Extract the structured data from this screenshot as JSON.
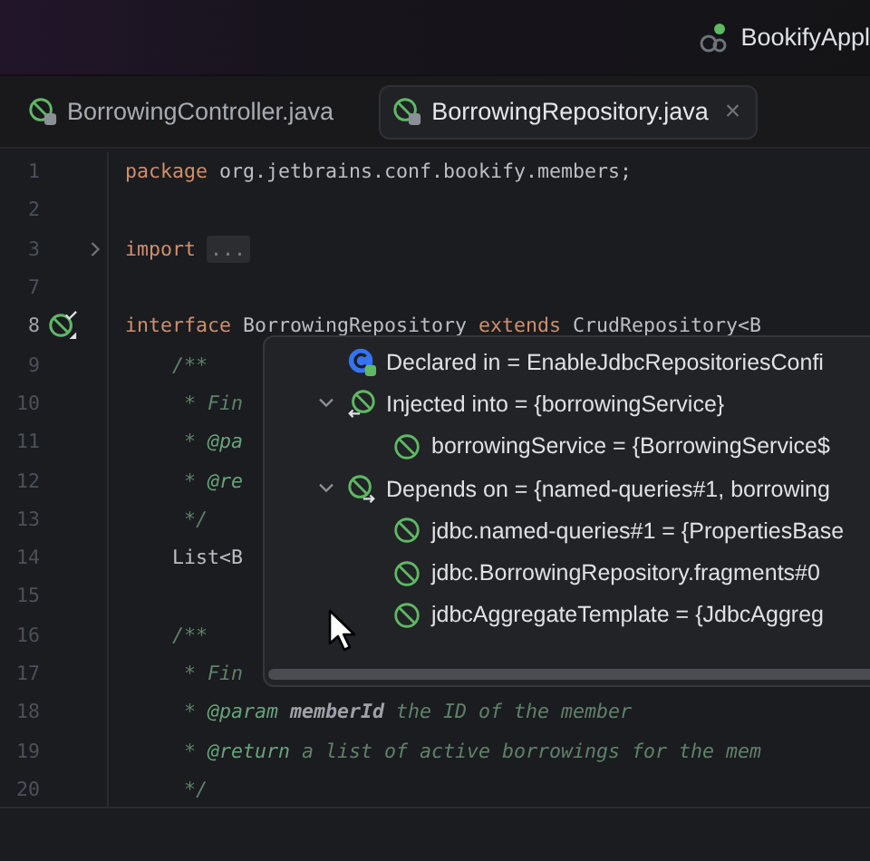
{
  "title_bar": {
    "run_configuration": "BookifyAppl"
  },
  "tabs": [
    {
      "label": "BorrowingController.java",
      "selected": false
    },
    {
      "label": "BorrowingRepository.java",
      "selected": true,
      "close": "×"
    }
  ],
  "editor": {
    "lines": [
      {
        "number": "1",
        "current": false,
        "tokens": [
          {
            "kind": "kw",
            "text": "package"
          },
          {
            "kind": "plain",
            "text": " org.jetbrains.conf.bookify.members;"
          }
        ]
      },
      {
        "number": "2",
        "current": false
      },
      {
        "number": "3",
        "current": false,
        "collapsed": true,
        "tokens": [
          {
            "kind": "kw",
            "text": "import"
          },
          {
            "kind": "fold",
            "text": "..."
          }
        ]
      },
      {
        "number": "7",
        "current": false
      },
      {
        "number": "8",
        "current": true,
        "bean_marker": true,
        "tokens": [
          {
            "kind": "kw",
            "text": "interface"
          },
          {
            "kind": "plain",
            "text": " BorrowingRepository "
          },
          {
            "kind": "kw",
            "text": "extends"
          },
          {
            "kind": "plain",
            "text": " CrudRepository<B"
          }
        ]
      },
      {
        "number": "9",
        "current": false,
        "tokens": [
          {
            "kind": "doc",
            "text": "    /**"
          }
        ]
      },
      {
        "number": "10",
        "current": false,
        "tokens": [
          {
            "kind": "doc",
            "text": "     * Fin"
          }
        ]
      },
      {
        "number": "11",
        "current": false,
        "tokens": [
          {
            "kind": "doc",
            "text": "     * "
          },
          {
            "kind": "tag",
            "text": "@pa"
          }
        ]
      },
      {
        "number": "12",
        "current": false,
        "tokens": [
          {
            "kind": "doc",
            "text": "     * "
          },
          {
            "kind": "tag",
            "text": "@re"
          }
        ]
      },
      {
        "number": "13",
        "current": false,
        "tokens": [
          {
            "kind": "doc",
            "text": "     */"
          }
        ]
      },
      {
        "number": "14",
        "current": false,
        "tokens": [
          {
            "kind": "plain",
            "text": "    List<B"
          }
        ]
      },
      {
        "number": "15",
        "current": false
      },
      {
        "number": "16",
        "current": false,
        "tokens": [
          {
            "kind": "doc",
            "text": "    /**"
          }
        ]
      },
      {
        "number": "17",
        "current": false,
        "tokens": [
          {
            "kind": "doc",
            "text": "     * Fin"
          }
        ]
      },
      {
        "number": "18",
        "current": false,
        "tokens": [
          {
            "kind": "doc",
            "text": "     * "
          },
          {
            "kind": "tag",
            "text": "@param"
          },
          {
            "kind": "param",
            "text": " memberId"
          },
          {
            "kind": "doc",
            "text": " the ID of the member"
          }
        ]
      },
      {
        "number": "19",
        "current": false,
        "tokens": [
          {
            "kind": "doc",
            "text": "     * "
          },
          {
            "kind": "tag",
            "text": "@return"
          },
          {
            "kind": "doc",
            "text": " a list of active borrowings for the mem"
          }
        ]
      },
      {
        "number": "20",
        "current": false,
        "tokens": [
          {
            "kind": "doc",
            "text": "     */"
          }
        ]
      }
    ]
  },
  "popup": {
    "items": [
      {
        "kind": "class",
        "label": "Declared in = EnableJdbcRepositoriesConfi"
      },
      {
        "kind": "injected",
        "label": "Injected into = {borrowingService}",
        "expanded": true,
        "children": [
          {
            "kind": "bean",
            "label": "borrowingService = {BorrowingService$"
          }
        ]
      },
      {
        "kind": "depends",
        "label": "Depends on = {named-queries#1, borrowing",
        "expanded": true,
        "children": [
          {
            "kind": "bean",
            "label": "jdbc.named-queries#1 = {PropertiesBase"
          },
          {
            "kind": "bean",
            "label": "jdbc.BorrowingRepository.fragments#0"
          },
          {
            "kind": "bean",
            "label": "jdbcAggregateTemplate = {JdbcAggreg"
          }
        ]
      }
    ]
  }
}
